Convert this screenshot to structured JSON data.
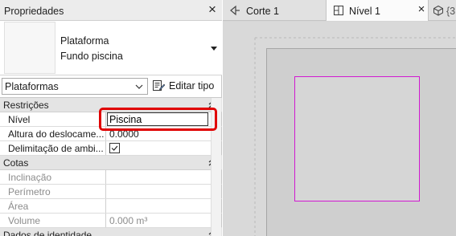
{
  "properties": {
    "title": "Propriedades",
    "type_family": "Plataforma",
    "type_name": "Fundo piscina",
    "filter_value": "Plataformas",
    "edit_type_label": "Editar tipo"
  },
  "grid": {
    "constraints": {
      "label": "Restrições",
      "level_label": "Nível",
      "level_value": "Piscina",
      "offset_label": "Altura do deslocame...",
      "offset_value": "0.0000",
      "room_bounding_label": "Delimitação de ambi...",
      "room_bounding_checked": true
    },
    "dimensions": {
      "label": "Cotas",
      "slope_label": "Inclinação",
      "perimeter_label": "Perímetro",
      "area_label": "Área",
      "volume_label": "Volume",
      "volume_value": "0.000 m³"
    },
    "identity": {
      "label": "Dados de identidade"
    }
  },
  "view_tabs": [
    {
      "label": "Corte 1",
      "active": false
    },
    {
      "label": "Nível 1",
      "active": true
    },
    {
      "label": "{3",
      "active": false
    }
  ],
  "colors": {
    "highlight": "#e00000",
    "pool_outline": "#d119d1"
  }
}
